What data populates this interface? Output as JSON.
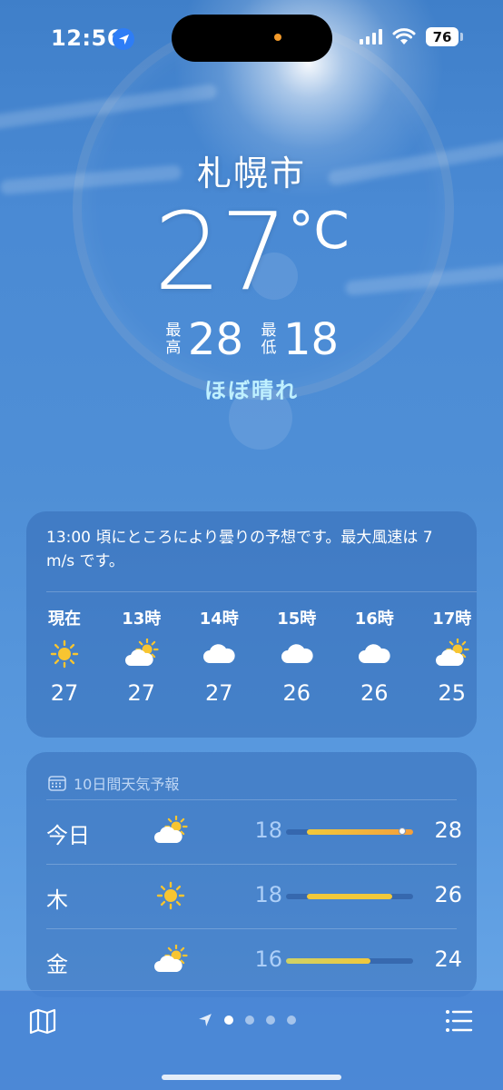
{
  "status_bar": {
    "time": "12:56",
    "battery": "76"
  },
  "header": {
    "city": "札幌市",
    "temperature": "27",
    "unit": "°C",
    "high_label_top": "最",
    "high_label_bottom": "高",
    "high": "28",
    "low_label_top": "最",
    "low_label_bottom": "低",
    "low": "18",
    "condition": "ほぼ晴れ"
  },
  "hourly": {
    "summary": "13:00 頃にところにより曇りの予想です。最大風速は 7 m/s です。",
    "hours": [
      {
        "label": "現在",
        "icon": "sun-icon",
        "temp": "27"
      },
      {
        "label": "13時",
        "icon": "partly-cloudy-icon",
        "temp": "27"
      },
      {
        "label": "14時",
        "icon": "cloud-icon",
        "temp": "27"
      },
      {
        "label": "15時",
        "icon": "cloud-icon",
        "temp": "26"
      },
      {
        "label": "16時",
        "icon": "cloud-icon",
        "temp": "26"
      },
      {
        "label": "17時",
        "icon": "partly-cloudy-icon",
        "temp": "25"
      }
    ]
  },
  "daily": {
    "title": "10日間天気予報",
    "range_min": 16,
    "range_max": 28,
    "days": [
      {
        "name": "今日",
        "icon": "partly-cloudy-icon",
        "low": "18",
        "high": "28",
        "low_val": 18,
        "high_val": 28,
        "current": 27
      },
      {
        "name": "木",
        "icon": "sun-icon",
        "low": "18",
        "high": "26",
        "low_val": 18,
        "high_val": 26
      },
      {
        "name": "金",
        "icon": "partly-cloudy-icon",
        "low": "16",
        "high": "24",
        "low_val": 16,
        "high_val": 24
      }
    ]
  },
  "bottom_bar": {
    "pages": 4,
    "active_page": 0
  },
  "colors": {
    "sun": "#f7c531",
    "bar_warm": "#f3a03c",
    "bar_mild": "#f1c83b",
    "bar_cool": "#cfd266"
  }
}
